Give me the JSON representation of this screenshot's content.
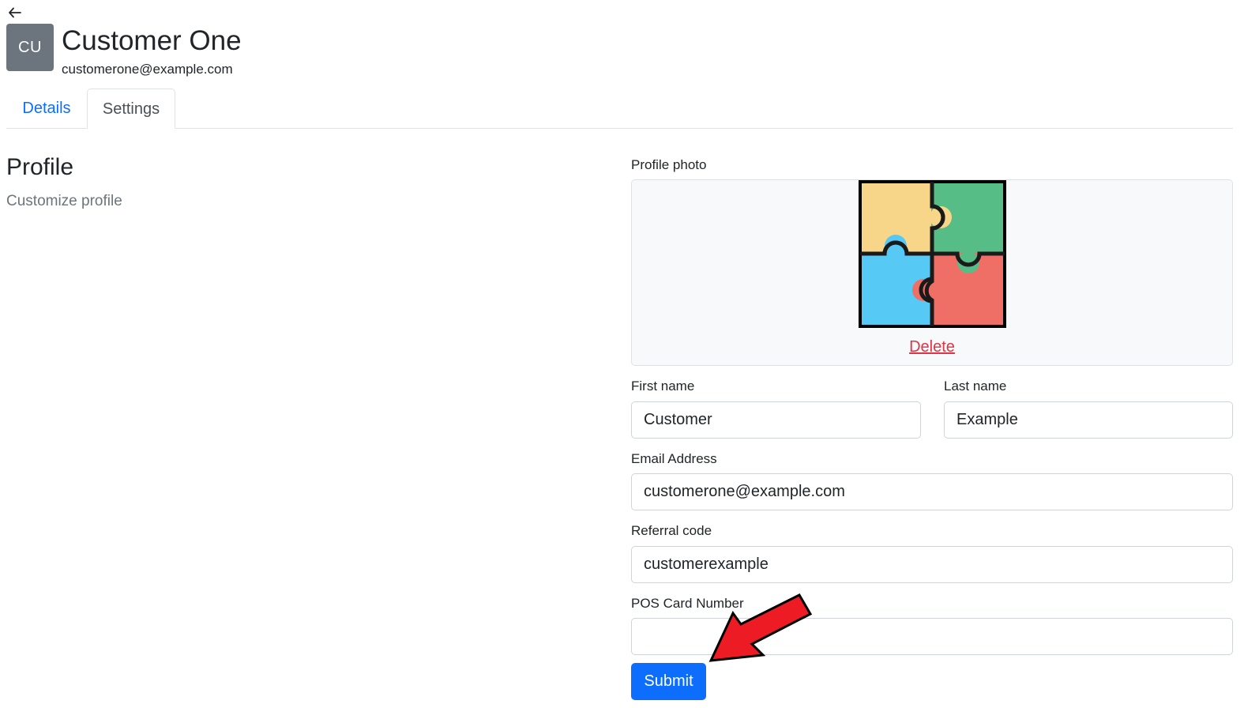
{
  "header": {
    "avatar_initials": "CU",
    "name": "Customer One",
    "email": "customerone@example.com"
  },
  "tabs": [
    {
      "label": "Details",
      "active": false
    },
    {
      "label": "Settings",
      "active": true
    }
  ],
  "section": {
    "title": "Profile",
    "subtitle": "Customize profile"
  },
  "form": {
    "profile_photo_label": "Profile photo",
    "delete_label": "Delete",
    "first_name": {
      "label": "First name",
      "value": "Customer"
    },
    "last_name": {
      "label": "Last name",
      "value": "Example"
    },
    "email": {
      "label": "Email Address",
      "value": "customerone@example.com"
    },
    "referral_code": {
      "label": "Referral code",
      "value": "customerexample"
    },
    "pos_card_number": {
      "label": "POS Card Number",
      "value": ""
    },
    "submit_label": "Submit"
  },
  "colors": {
    "accent": "#0d6efd",
    "danger": "#dc3545",
    "avatar_bg": "#6c757d",
    "annotation_arrow": "#ed1c24"
  },
  "icons": {
    "back": "arrow-left-icon",
    "photo": "puzzle-icon",
    "annotation": "red-arrow-icon"
  }
}
